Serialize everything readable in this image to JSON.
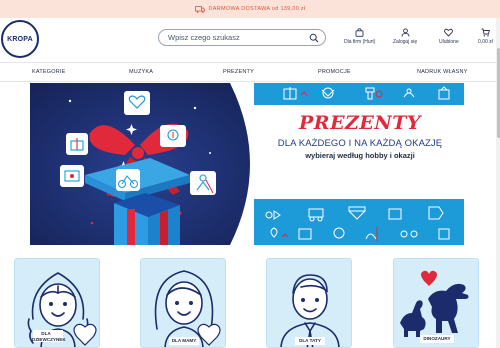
{
  "promo": {
    "text": "DARMOWA DOSTAWA od 139,00 zł"
  },
  "header": {
    "logo_text": "KROPA",
    "search_placeholder": "Wpisz czego szukasz",
    "actions": [
      {
        "label": "Dla firm (Hurt)",
        "icon": "bag-icon"
      },
      {
        "label": "Zaloguj się",
        "icon": "user-icon"
      },
      {
        "label": "Ulubione",
        "icon": "heart-icon"
      },
      {
        "label": "0,00 zł",
        "icon": "cart-icon"
      }
    ]
  },
  "nav": {
    "items": [
      {
        "label": "KATEGORIE"
      },
      {
        "label": "MUZYKA"
      },
      {
        "label": "PREZENTY"
      },
      {
        "label": "PROMOCJE"
      },
      {
        "label": "NADRUK WŁASNY"
      }
    ]
  },
  "hero": {
    "title": "PREZENTY",
    "subtitle1": "DLA KAŻDEGO I NA KAŻDĄ OKAZJĘ",
    "subtitle2": "wybieraj według hobby i okazji"
  },
  "categories": [
    {
      "label": "DLA DZIEWCZYNEK",
      "icon": "girl-icon"
    },
    {
      "label": "DLA MAMY",
      "icon": "mom-icon"
    },
    {
      "label": "DLA TATY",
      "icon": "dad-icon"
    },
    {
      "label": "DINOZAURY",
      "icon": "dinosaur-icon"
    }
  ],
  "colors": {
    "promo_bg": "#fbe3da",
    "promo_text": "#d9573a",
    "hero_navy": "#1c2b6b",
    "hero_blue": "#1d9ad8",
    "hero_red": "#e0293a",
    "card_bg": "#d5edf8"
  }
}
